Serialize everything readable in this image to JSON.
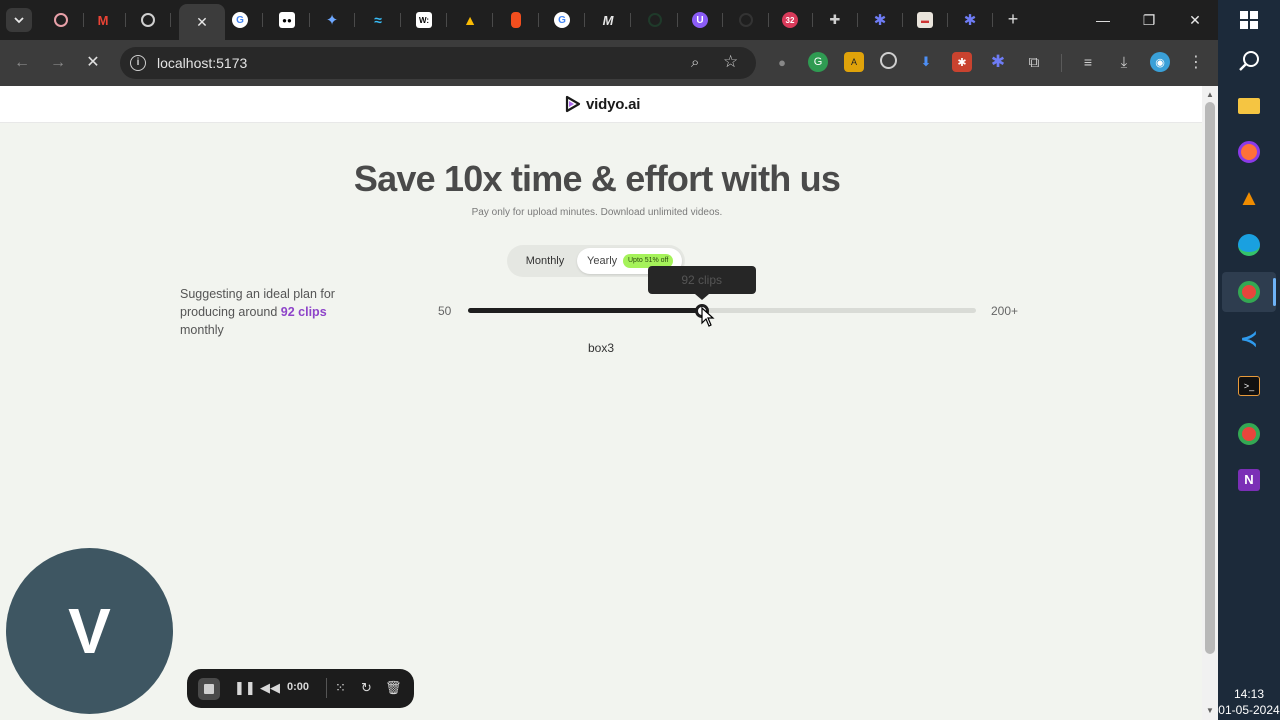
{
  "browser": {
    "url": "localhost:5173",
    "extensions_badge": "32"
  },
  "site": {
    "logo_text": "vidyo.ai",
    "hero_title": "Save 10x time & effort with us",
    "hero_subtitle": "Pay only for upload minutes. Download unlimited videos.",
    "billing_toggle": {
      "monthly_label": "Monthly",
      "yearly_label": "Yearly",
      "yearly_badge": "Upto 51% off",
      "selected": "Yearly"
    },
    "suggestion": {
      "prefix": "Suggesting an ideal plan for producing around",
      "clips": "92 clips",
      "suffix": "monthly"
    },
    "slider": {
      "min_label": "50",
      "max_label": "200+",
      "tooltip": "92 clips",
      "fill_fraction": 0.46
    },
    "box_label": "box3"
  },
  "recorder": {
    "avatar_letter": "V",
    "time": "0:00"
  },
  "taskbar": {
    "time": "14:13",
    "date": "01-05-2024"
  }
}
